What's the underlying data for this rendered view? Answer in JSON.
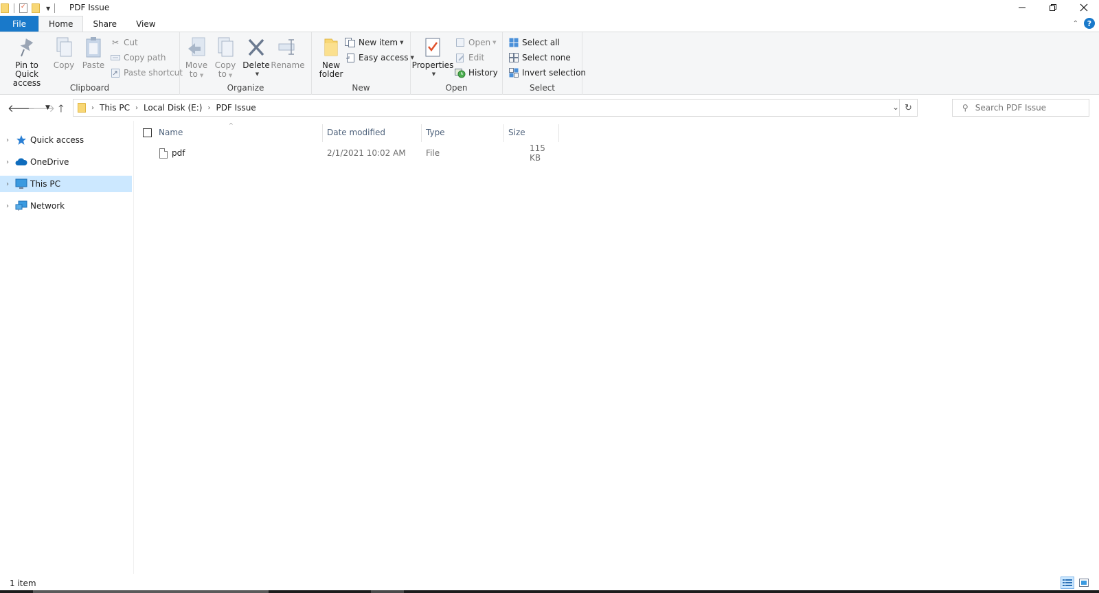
{
  "window": {
    "title": "PDF Issue",
    "controls": [
      "minimize",
      "restore",
      "close"
    ]
  },
  "tabs": {
    "file": "File",
    "home": "Home",
    "share": "Share",
    "view": "View",
    "help": "?"
  },
  "ribbon": {
    "clipboard": {
      "label": "Clipboard",
      "pin_line1": "Pin to Quick",
      "pin_line2": "access",
      "copy": "Copy",
      "paste": "Paste",
      "cut": "Cut",
      "copy_path": "Copy path",
      "paste_shortcut": "Paste shortcut"
    },
    "organize": {
      "label": "Organize",
      "move_to_1": "Move",
      "move_to_2": "to",
      "copy_to_1": "Copy",
      "copy_to_2": "to",
      "delete": "Delete",
      "rename": "Rename"
    },
    "new": {
      "label": "New",
      "new_folder_1": "New",
      "new_folder_2": "folder",
      "new_item": "New item",
      "easy_access": "Easy access"
    },
    "open": {
      "label": "Open",
      "properties": "Properties",
      "open": "Open",
      "edit": "Edit",
      "history": "History"
    },
    "select": {
      "label": "Select",
      "select_all": "Select all",
      "select_none": "Select none",
      "invert_selection": "Invert selection"
    }
  },
  "address": {
    "crumbs": [
      "This PC",
      "Local Disk (E:)",
      "PDF Issue"
    ],
    "search_placeholder": "Search PDF Issue"
  },
  "nav_pane": {
    "items": [
      {
        "label": "Quick access",
        "icon": "star-icon"
      },
      {
        "label": "OneDrive",
        "icon": "cloud-icon"
      },
      {
        "label": "This PC",
        "icon": "computer-icon",
        "selected": true
      },
      {
        "label": "Network",
        "icon": "network-icon"
      }
    ]
  },
  "file_list": {
    "columns": [
      "Name",
      "Date modified",
      "Type",
      "Size"
    ],
    "rows": [
      {
        "name": "pdf",
        "date_modified": "2/1/2021 10:02 AM",
        "type": "File",
        "size": "115 KB"
      }
    ]
  },
  "status_bar": {
    "item_count": "1 item"
  },
  "colors": {
    "accent": "#1979ca",
    "selection": "#cce8ff",
    "ribbon_bg": "#f5f6f7"
  }
}
